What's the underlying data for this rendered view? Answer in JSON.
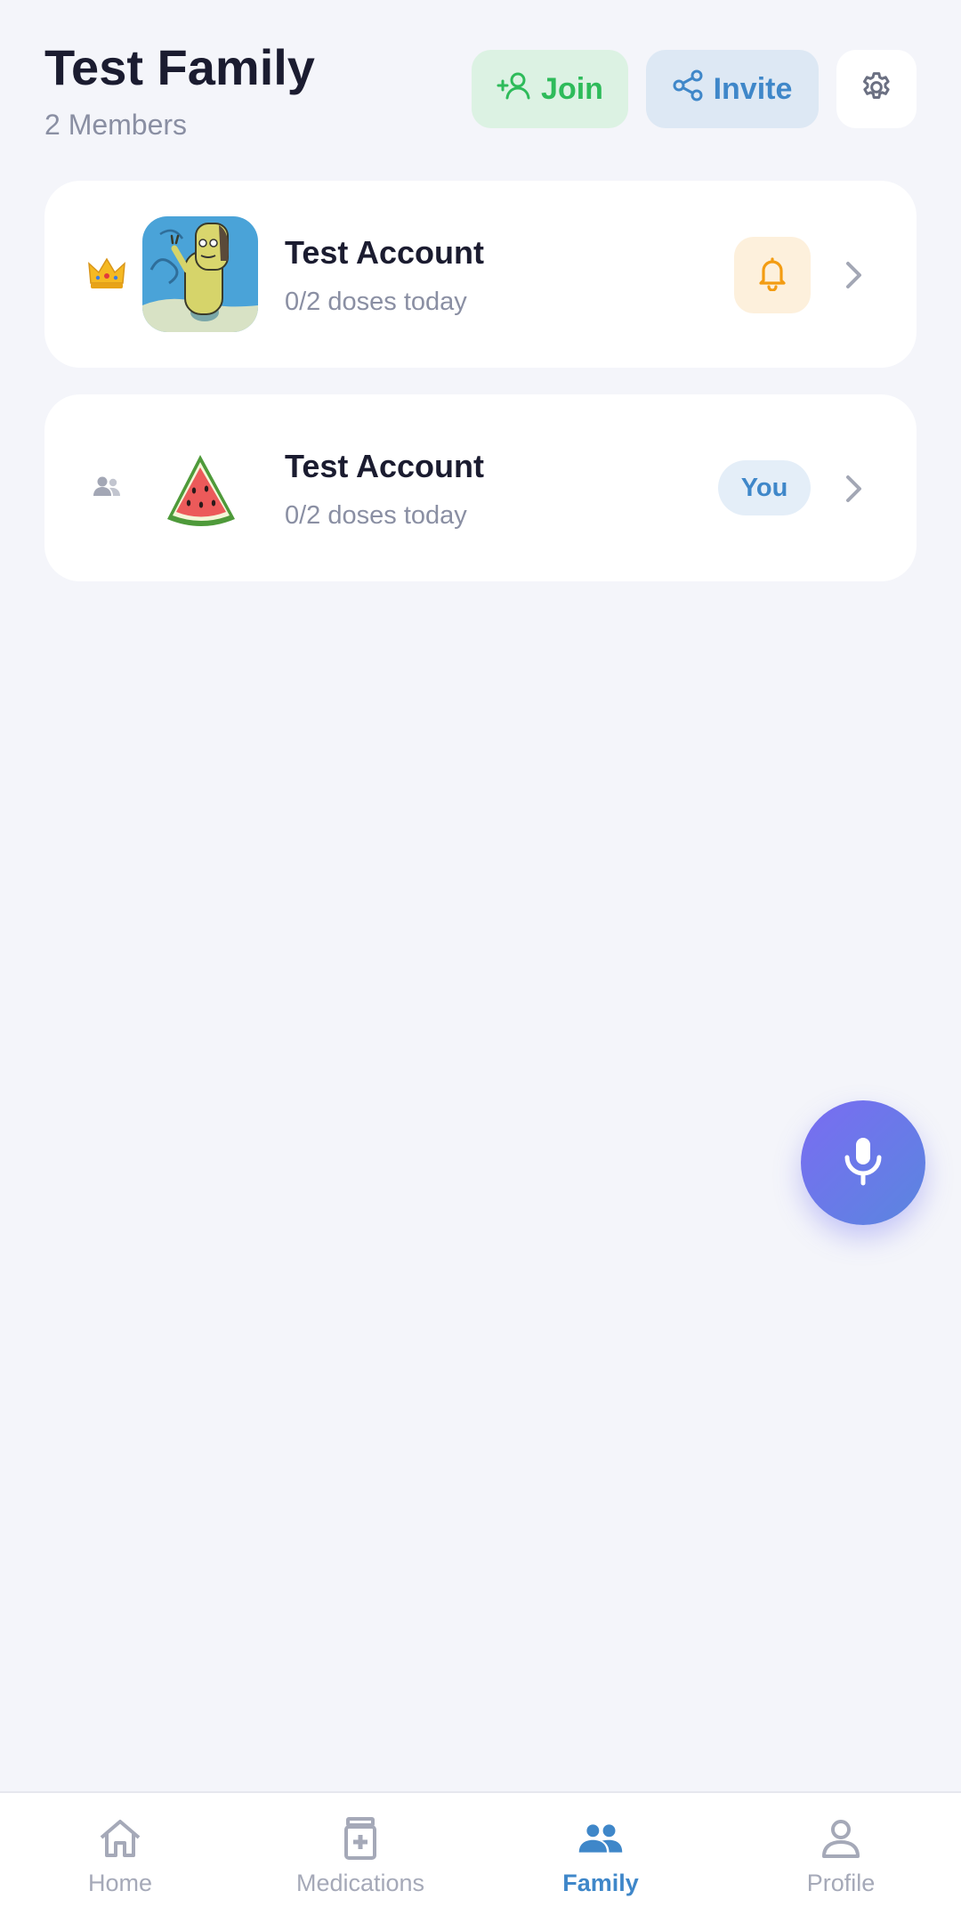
{
  "header": {
    "title": "Test Family",
    "subtitle": "2 Members",
    "join_label": "Join",
    "invite_label": "Invite"
  },
  "members": [
    {
      "role_icon": "crown-icon",
      "name": "Test Account",
      "status": "0/2 doses today",
      "action": "bell-icon"
    },
    {
      "role_icon": "people-icon",
      "name": "Test Account",
      "status": "0/2 doses today",
      "badge": "You"
    }
  ],
  "nav": {
    "items": [
      {
        "label": "Home",
        "icon": "home-icon"
      },
      {
        "label": "Medications",
        "icon": "medication-icon"
      },
      {
        "label": "Family",
        "icon": "family-icon",
        "active": true
      },
      {
        "label": "Profile",
        "icon": "profile-icon"
      }
    ]
  },
  "colors": {
    "accent": "#3f87c9",
    "join_green": "#2ebb5a",
    "bell_orange": "#f39c12",
    "background": "#f4f5fa"
  }
}
